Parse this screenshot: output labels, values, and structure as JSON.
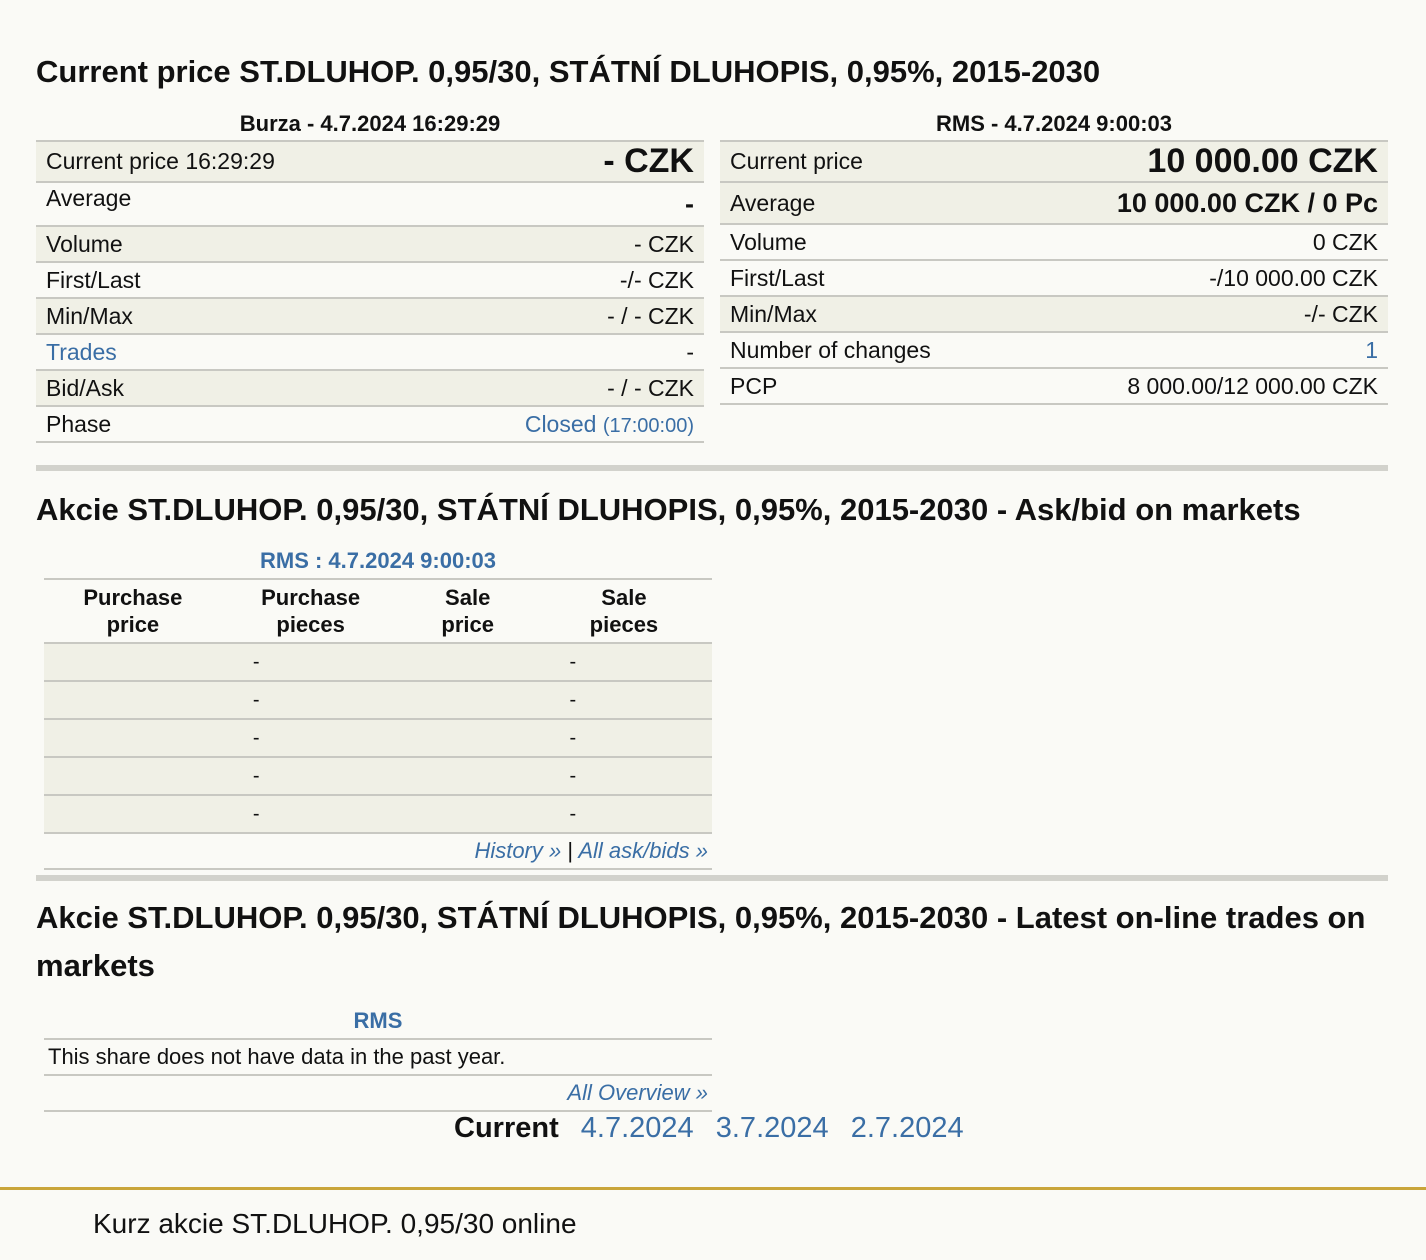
{
  "current_price": {
    "heading": "Current price ST.DLUHOP. 0,95/30, STÁTNÍ DLUHOPIS, 0,95%, 2015-2030",
    "burza": {
      "header": "Burza - 4.7.2024 16:29:29",
      "rows": [
        {
          "label": "Current price 16:29:29",
          "value": "- CZK"
        },
        {
          "label": "Average",
          "value": "-"
        },
        {
          "label": "Volume",
          "value": "- CZK"
        },
        {
          "label": "First/Last",
          "value": "-/- CZK"
        },
        {
          "label": "Min/Max",
          "value": "- / - CZK"
        },
        {
          "label": "Trades",
          "value": "-"
        },
        {
          "label": "Bid/Ask",
          "value": "- / - CZK"
        },
        {
          "label": "Phase",
          "value": "Closed",
          "value_extra": "(17:00:00)"
        }
      ]
    },
    "rms": {
      "header": "RMS - 4.7.2024 9:00:03",
      "rows": [
        {
          "label": "Current price",
          "value": "10 000.00 CZK"
        },
        {
          "label": "Average",
          "value": "10 000.00 CZK / 0 Pc"
        },
        {
          "label": "Volume",
          "value": "0 CZK"
        },
        {
          "label": "First/Last",
          "value": "-/10 000.00 CZK"
        },
        {
          "label": "Min/Max",
          "value": "-/- CZK"
        },
        {
          "label": "Number of changes",
          "value": "1"
        },
        {
          "label": "PCP",
          "value": "8 000.00/12 000.00 CZK"
        }
      ]
    }
  },
  "ask_bid": {
    "heading": "Akcie ST.DLUHOP. 0,95/30, STÁTNÍ DLUHOPIS, 0,95%, 2015-2030 - Ask/bid on markets",
    "market_header": "RMS : 4.7.2024 9:00:03",
    "columns": [
      {
        "line1": "Purchase",
        "line2": "price"
      },
      {
        "line1": "Purchase",
        "line2": "pieces"
      },
      {
        "line1": "Sale",
        "line2": "price"
      },
      {
        "line1": "Sale",
        "line2": "pieces"
      }
    ],
    "rows": [
      [
        "-",
        "-"
      ],
      [
        "-",
        "-"
      ],
      [
        "-",
        "-"
      ],
      [
        "-",
        "-"
      ],
      [
        "-",
        "-"
      ]
    ],
    "history_link": "History »",
    "separator": "|",
    "all_askbids_link": "All ask/bids »"
  },
  "trades": {
    "heading": "Akcie ST.DLUHOP. 0,95/30, STÁTNÍ DLUHOPIS, 0,95%, 2015-2030 - Latest on-line trades on markets",
    "market_header": "RMS",
    "no_data": "This share does not have data in the past year.",
    "all_overview_link": "All Overview »",
    "dates_label": "Current",
    "dates": [
      "4.7.2024",
      "3.7.2024",
      "2.7.2024"
    ]
  },
  "footer": {
    "text": "Kurz akcie ST.DLUHOP. 0,95/30 online"
  },
  "colors": {
    "link": "#3a6ea5",
    "row_alt": "#f0f0e6",
    "footer_line": "#c9a53a"
  }
}
